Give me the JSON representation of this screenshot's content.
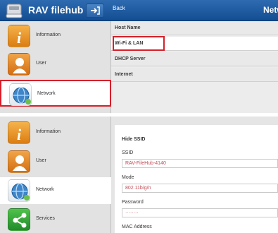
{
  "header": {
    "app_title": "RAV filehub",
    "back_label": "Back",
    "page_title": "Network"
  },
  "sidebar_top": {
    "items": [
      {
        "label": "Information",
        "icon": "info-icon"
      },
      {
        "label": "User",
        "icon": "user-icon"
      },
      {
        "label": "Network",
        "icon": "network-icon"
      }
    ]
  },
  "network_menu": {
    "rows": [
      {
        "label": "Host Name"
      },
      {
        "label": "Wi-Fi & LAN"
      },
      {
        "label": "DHCP Server"
      },
      {
        "label": "Internet"
      }
    ]
  },
  "sidebar_bottom": {
    "items": [
      {
        "label": "Information",
        "icon": "info-icon"
      },
      {
        "label": "User",
        "icon": "user-icon"
      },
      {
        "label": "Network",
        "icon": "network-icon"
      },
      {
        "label": "Services",
        "icon": "share-icon"
      }
    ]
  },
  "wifi_form": {
    "hide_ssid_label": "Hide SSID",
    "ssid_label": "SSID",
    "ssid_value": "RAV-FileHub-4140",
    "mode_label": "Mode",
    "mode_value": "802.11b/g/n",
    "password_label": "Password",
    "password_value": "········",
    "mac_label": "MAC Address"
  },
  "colors": {
    "header_blue": "#1b5aa3",
    "highlight_red": "#d71f2a",
    "input_text": "#c24b55"
  }
}
